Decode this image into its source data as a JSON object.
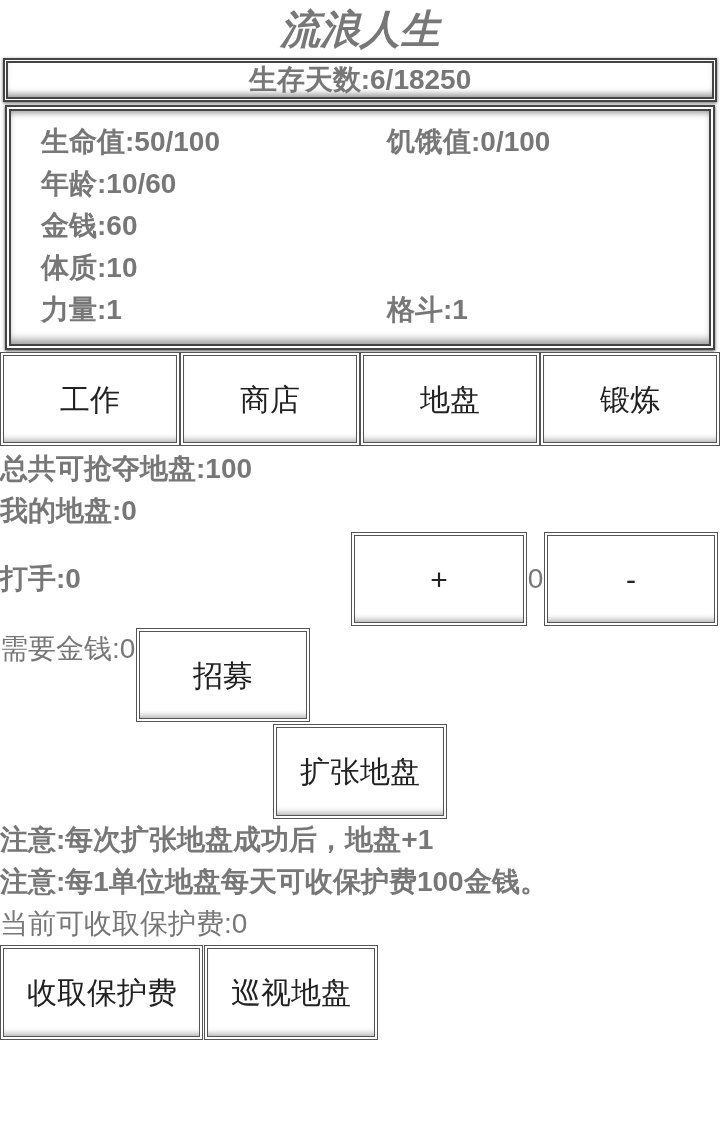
{
  "title": "流浪人生",
  "days": "生存天数:6/18250",
  "stats": [
    {
      "cells": [
        "生命值:50/100",
        "饥饿值:0/100"
      ]
    },
    {
      "cells": [
        "年龄:10/60"
      ]
    },
    {
      "cells": [
        "金钱:60"
      ]
    },
    {
      "cells": [
        "体质:10"
      ]
    },
    {
      "cells": [
        "力量:1",
        "格斗:1"
      ]
    }
  ],
  "nav": [
    "工作",
    "商店",
    "地盘",
    "锻炼"
  ],
  "territory": {
    "total": "总共可抢夺地盘:100",
    "mine": "我的地盘:0",
    "thugs": {
      "label": "打手:0",
      "plus": "+",
      "count": "0",
      "minus": "-"
    },
    "cost": "需要金钱:0",
    "recruit": "招募",
    "expand": "扩张地盘",
    "notes": [
      "注意:每次扩张地盘成功后，地盘+1",
      "注意:每1单位地盘每天可收保护费100金钱。"
    ],
    "fee": "当前可收取保护费:0",
    "actions": [
      "收取保护费",
      "巡视地盘"
    ]
  }
}
